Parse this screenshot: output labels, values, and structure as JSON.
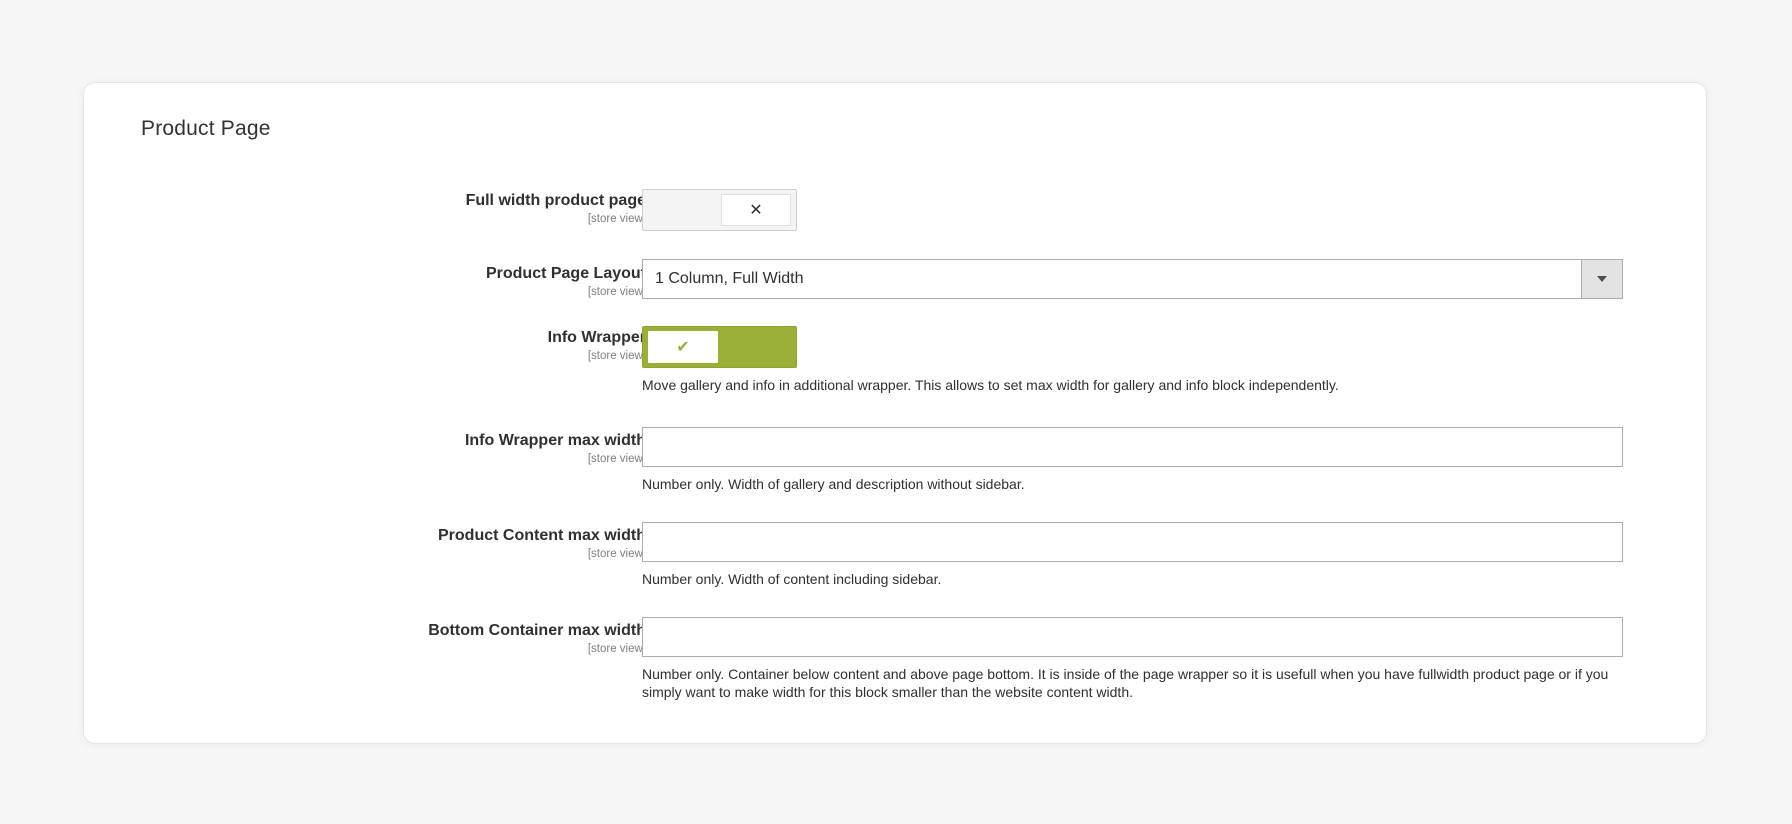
{
  "section": {
    "title": "Product Page"
  },
  "fields": {
    "full_width": {
      "label": "Full width product page",
      "scope": "[store view]",
      "toggle_icon": "close-icon",
      "state": "off"
    },
    "layout": {
      "label": "Product Page Layout",
      "scope": "[store view]",
      "selected": "1 Column, Full Width"
    },
    "info_wrapper": {
      "label": "Info Wrapper",
      "scope": "[store view]",
      "toggle_icon": "check-icon",
      "state": "on",
      "note": "Move gallery and info in additional wrapper. This allows to set max width for gallery and info block independently."
    },
    "info_wrapper_max_width": {
      "label": "Info Wrapper max width",
      "scope": "[store view]",
      "value": "",
      "note": "Number only. Width of gallery and description without sidebar."
    },
    "product_content_max_width": {
      "label": "Product Content max width",
      "scope": "[store view]",
      "value": "",
      "note": "Number only. Width of content including sidebar."
    },
    "bottom_container_max_width": {
      "label": "Bottom Container max width",
      "scope": "[store view]",
      "value": "",
      "note": "Number only. Container below content and above page bottom. It is inside of the page wrapper so it is usefull when you have fullwidth product page or if you simply want to make width for this block smaller than the website content width."
    }
  },
  "colors": {
    "toggle_on": "#9aaf35",
    "background": "#f7f7f7"
  }
}
